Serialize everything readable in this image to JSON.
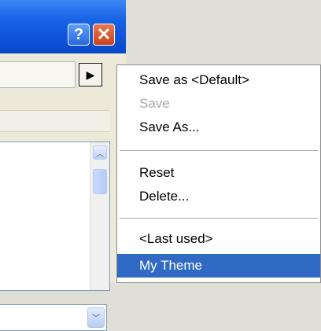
{
  "window": {
    "help_button": "?",
    "close_button": "✕",
    "arrow_icon": "▶",
    "dropdown_icon": "chevron-down-icon",
    "scroll_up_icon": "chevron-up-icon"
  },
  "menu": {
    "items": [
      {
        "label": "Save as <Default>",
        "enabled": true,
        "selected": false
      },
      {
        "label": "Save",
        "enabled": false,
        "selected": false
      },
      {
        "label": "Save As...",
        "enabled": true,
        "selected": false
      },
      {
        "label": "Reset",
        "enabled": true,
        "selected": false
      },
      {
        "label": "Delete...",
        "enabled": true,
        "selected": false
      },
      {
        "label": "<Last used>",
        "enabled": true,
        "selected": false
      },
      {
        "label": "My Theme",
        "enabled": true,
        "selected": true
      }
    ]
  },
  "colors": {
    "title_bar": "#0e52d8",
    "selection": "#316ac5",
    "disabled_text": "#a9a9a9"
  }
}
